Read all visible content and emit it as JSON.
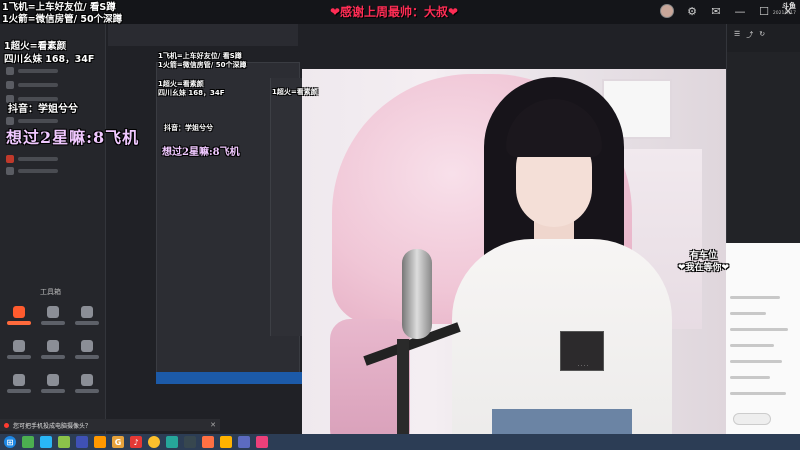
{
  "header": {
    "thanks_banner": "❤感谢上周最帅：大叔❤"
  },
  "overlay": {
    "line1": "1飞机=上车好友位/  看S蹲",
    "line2": "1火箭=微信房管/  50个深蹲",
    "line3": "1超火=看素颜",
    "line4": "四川幺妹 168，34F",
    "line5": "抖音：学姐兮兮",
    "line6": "想过2星嘛:8飞机"
  },
  "sidebar": {
    "tools_title": "工具箱"
  },
  "video": {
    "bubble_line1": "有车位",
    "bubble_line2": "❤我在等你❤"
  },
  "notice": {
    "text": "您可把手机投成电脑摄像头？"
  },
  "tray": {
    "logo": "斗鱼",
    "date": "2021/7/17"
  },
  "colors": {
    "banner_red": "#ff2d55",
    "accent_orange": "#ff5b2e",
    "taskbar": "#2c3d55",
    "video_pink": "#f0c6d6"
  },
  "icons": [
    "user-avatar-icon",
    "gear-icon",
    "mail-icon",
    "minimize-icon",
    "maximize-icon",
    "close-icon",
    "windows-start-icon",
    "browser-icon",
    "douyu-icon"
  ]
}
